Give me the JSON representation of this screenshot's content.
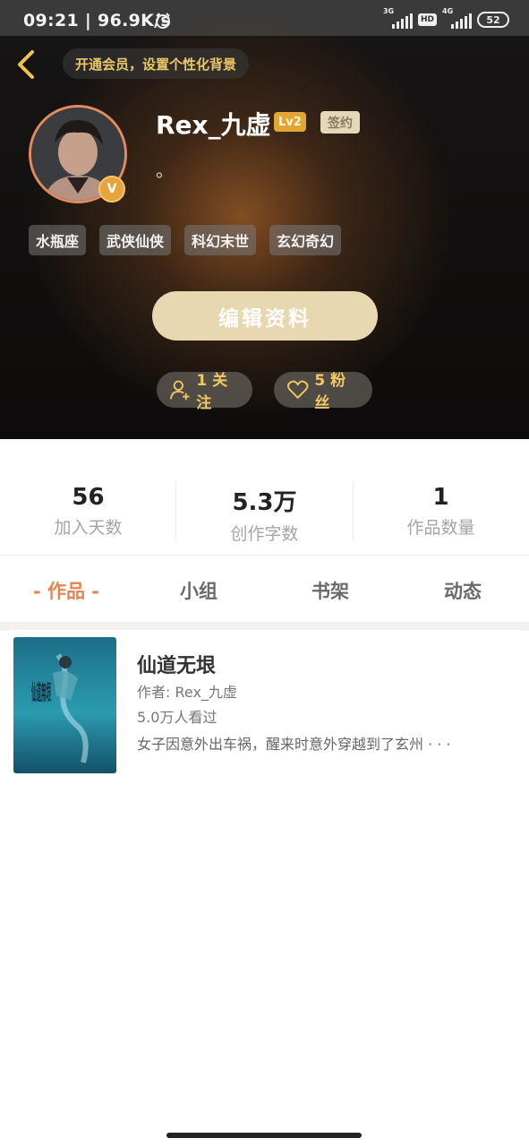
{
  "status_bar": {
    "time_speed": "09:21 | 96.9K/s",
    "network_1": "3G",
    "hd": "HD",
    "network_2": "4G",
    "battery": "52"
  },
  "nav": {
    "back_icon": "chevron-left-icon",
    "vip_banner": "开通会员，设置个性化背景"
  },
  "profile": {
    "username": "Rex_九虚",
    "level": "Lv2",
    "signed": "签约",
    "bio": "。",
    "v_badge": "V",
    "tags": [
      "水瓶座",
      "武侠仙侠",
      "科幻末世",
      "玄幻奇幻"
    ],
    "edit_button": "编辑资料",
    "follow_label": "1 关注",
    "fans_label": "5 粉丝"
  },
  "stats": [
    {
      "value": "56",
      "label": "加入天数"
    },
    {
      "value": "5.3万",
      "label": "创作字数"
    },
    {
      "value": "1",
      "label": "作品数量"
    }
  ],
  "tabs": [
    "- 作品 -",
    "小组",
    "书架",
    "动态"
  ],
  "active_tab": 0,
  "books": [
    {
      "title": "仙道无垠",
      "author": "作者: Rex_九虚",
      "views": "5.0万人看过",
      "description": "女子因意外出车祸，醒来时意外穿越到了玄州 · · ·",
      "cover_text": "仙道無垠"
    }
  ],
  "colors": {
    "accent": "#e6844f",
    "gold": "#f0c860",
    "edit_button": "#e8d8b2"
  }
}
